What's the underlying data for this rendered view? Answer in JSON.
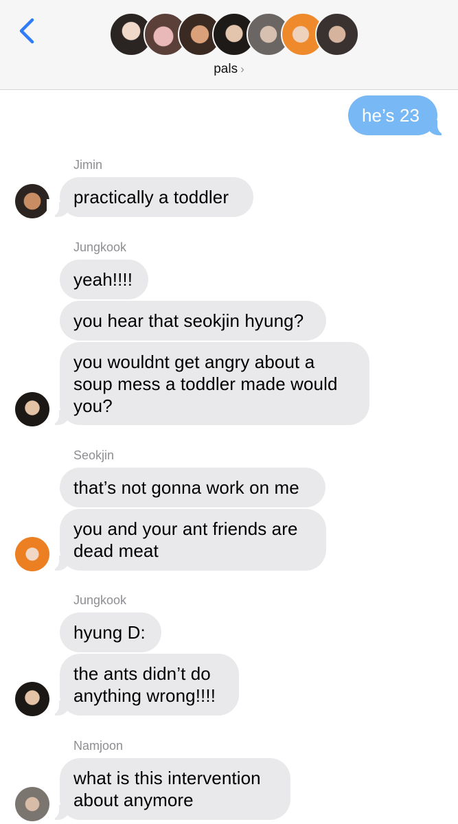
{
  "header": {
    "group_name": "pals",
    "chevron": "›",
    "member_avatars": [
      "avatar-1",
      "avatar-2",
      "avatar-3",
      "avatar-4",
      "avatar-5",
      "avatar-6",
      "avatar-7"
    ]
  },
  "colors": {
    "outgoing_bubble": "#78b8f4",
    "incoming_bubble": "#e9e9eb",
    "accent": "#2f7cf6",
    "sender_name": "#8e8e93"
  },
  "messages": [
    {
      "from": "me",
      "text": "he’s 23"
    },
    {
      "from": "Jimin",
      "sender_label": "Jimin",
      "text": "practically a toddler"
    },
    {
      "from": "Jungkook",
      "sender_label": "Jungkook",
      "text": "yeah!!!!"
    },
    {
      "from": "Jungkook",
      "text": "you hear that seokjin hyung?"
    },
    {
      "from": "Jungkook",
      "text": "you wouldnt get angry about a\nsoup mess a toddler made would\nyou?"
    },
    {
      "from": "Seokjin",
      "sender_label": "Seokjin",
      "text": "that’s not gonna work on me"
    },
    {
      "from": "Seokjin",
      "text": "you and your ant friends are\ndead meat"
    },
    {
      "from": "Jungkook",
      "sender_label": "Jungkook",
      "text": "hyung D:"
    },
    {
      "from": "Jungkook",
      "text": "the ants didn’t do\nanything wrong!!!!"
    },
    {
      "from": "Namjoon",
      "sender_label": "Namjoon",
      "text": "what is this intervention\nabout anymore"
    }
  ]
}
